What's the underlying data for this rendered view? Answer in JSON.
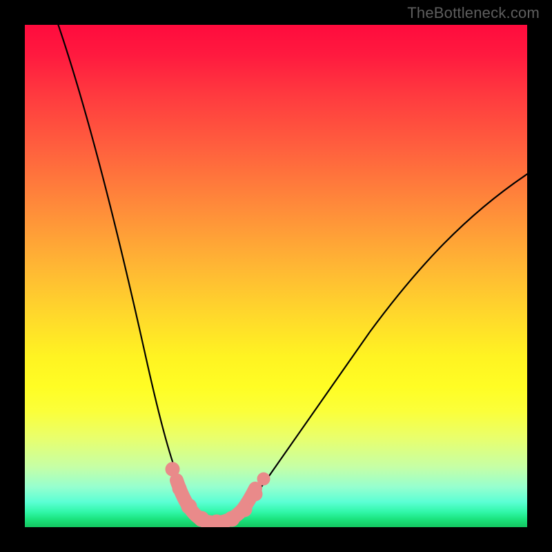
{
  "watermark": "TheBottleneck.com",
  "colors": {
    "frame": "#000000",
    "curve": "#000000",
    "marker_fill": "#e98a8a",
    "marker_stroke": "#d57878",
    "gradient_top": "#ff0b3d",
    "gradient_mid": "#fff322",
    "gradient_bottom": "#14c560"
  },
  "chart_data": {
    "type": "line",
    "title": "",
    "xlabel": "",
    "ylabel": "",
    "xlim": [
      0,
      100
    ],
    "ylim": [
      0,
      100
    ],
    "grid": false,
    "legend": false,
    "note": "Axes are unlabeled in the source image; x and y ranges are normalized 0–100. Values below are estimated from the plotted curve shape. The curve is a steep V that bottoms out around x≈34–40 at y≈1 and rises toward y=100 at the left edge and y≈60 at the right edge.",
    "series": [
      {
        "name": "curve",
        "x": [
          4,
          8,
          12,
          16,
          20,
          24,
          28,
          32,
          34,
          36,
          38,
          40,
          44,
          50,
          56,
          62,
          70,
          78,
          86,
          94,
          100
        ],
        "y": [
          100,
          84,
          68,
          54,
          41,
          30,
          20,
          10,
          4,
          1,
          1,
          2,
          5,
          11,
          18,
          25,
          34,
          42,
          50,
          56,
          60
        ]
      }
    ],
    "markers": {
      "name": "highlighted-points",
      "style": "pink-round",
      "x": [
        28,
        30,
        32,
        34,
        36,
        38,
        40,
        42,
        44
      ],
      "y": [
        12,
        7,
        4,
        2,
        1,
        1,
        2,
        4,
        7
      ]
    }
  }
}
